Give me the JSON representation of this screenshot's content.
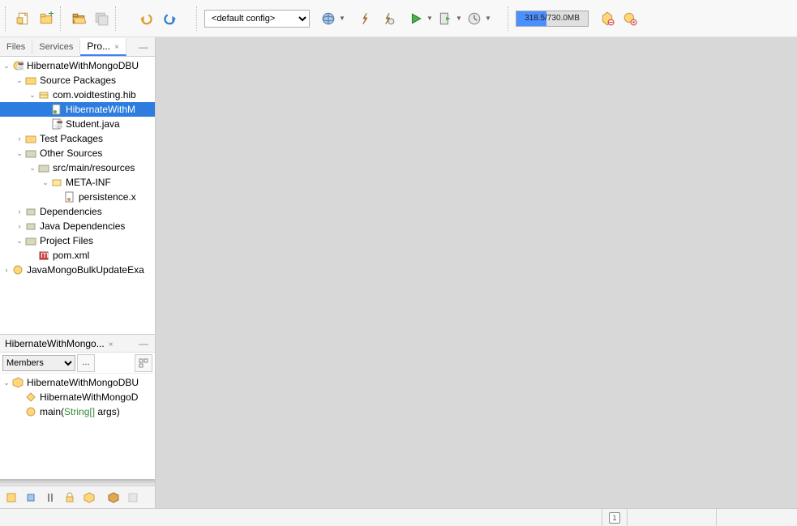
{
  "toolbar": {
    "config_selected": "<default config>",
    "memory": "318.5/730.0MB"
  },
  "side_tabs": {
    "files": "Files",
    "services": "Services",
    "projects": "Pro..."
  },
  "tree": {
    "project1": "HibernateWithMongoDBU",
    "source_packages": "Source Packages",
    "package": "com.voidtesting.hib",
    "file_selected": "HibernateWithM",
    "file_student": "Student.java",
    "test_packages": "Test Packages",
    "other_sources": "Other Sources",
    "resources": "src/main/resources",
    "metainf": "META-INF",
    "persistence": "persistence.x",
    "dependencies": "Dependencies",
    "java_dependencies": "Java Dependencies",
    "project_files": "Project Files",
    "pom": "pom.xml",
    "project2": "JavaMongoBulkUpdateExa"
  },
  "navigator": {
    "tab": "HibernateWithMongo...",
    "view_select": "Members",
    "class": "HibernateWithMongoDBU",
    "constructor": "HibernateWithMongoD",
    "method": "main",
    "method_param_type": "String[]",
    "method_param_name": " args"
  },
  "status": {
    "notif": "1"
  }
}
